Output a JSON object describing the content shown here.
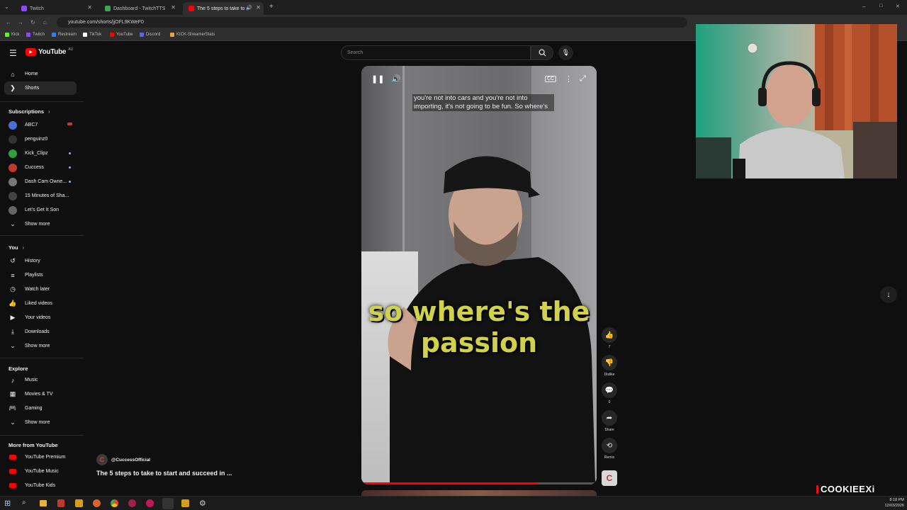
{
  "browser": {
    "tabs": [
      {
        "title": "Twitch",
        "color": "#9146ff"
      },
      {
        "title": "Dashboard - TwitchTTS",
        "color": "#3aa655"
      },
      {
        "title": "The 5 steps to take to start",
        "color": "#ff0000"
      }
    ],
    "url": "youtube.com/shorts/jjOFL9KWeF0",
    "bookmarks": [
      {
        "label": "Kick",
        "color": "#53fc18"
      },
      {
        "label": "Twitch",
        "color": "#9146ff"
      },
      {
        "label": "Restream",
        "color": "#2d7cff"
      },
      {
        "label": "TikTok",
        "color": "#ffffff"
      },
      {
        "label": "YouTube",
        "color": "#ff0000"
      },
      {
        "label": "Discord",
        "color": "#5865f2"
      },
      {
        "label": "KICK-StreamerStats",
        "color": "#e8a33b"
      }
    ]
  },
  "youtube": {
    "logo_text": "YouTube",
    "region": "AU",
    "search_placeholder": "Search"
  },
  "sidebar": {
    "main": [
      {
        "label": "Home",
        "icon": "home-icon"
      },
      {
        "label": "Shorts",
        "icon": "shorts-icon"
      }
    ],
    "subscriptions_title": "Subscriptions",
    "subscriptions": [
      {
        "label": "ABC7",
        "color": "#4a6fd4"
      },
      {
        "label": "penguinz0",
        "color": "#333333"
      },
      {
        "label": "Kick_Clipz",
        "color": "#2ea043"
      },
      {
        "label": "Cuccess",
        "color": "#c0392b"
      },
      {
        "label": "Dash Cam Owne...",
        "color": "#777777"
      },
      {
        "label": "15 Minutes of Sha...",
        "color": "#444444"
      },
      {
        "label": "Let's Get It Son",
        "color": "#666666"
      }
    ],
    "subs_show_more": "Show more",
    "you_title": "You",
    "you": [
      {
        "label": "History",
        "icon": "history-icon"
      },
      {
        "label": "Playlists",
        "icon": "playlists-icon"
      },
      {
        "label": "Watch later",
        "icon": "watch-later-icon"
      },
      {
        "label": "Liked videos",
        "icon": "thumbs-up-icon"
      },
      {
        "label": "Your videos",
        "icon": "play-icon"
      },
      {
        "label": "Downloads",
        "icon": "download-icon"
      }
    ],
    "you_show_more": "Show more",
    "explore_title": "Explore",
    "explore": [
      {
        "label": "Music",
        "icon": "music-icon"
      },
      {
        "label": "Movies & TV",
        "icon": "film-icon"
      },
      {
        "label": "Gaming",
        "icon": "gamepad-icon"
      }
    ],
    "explore_show_more": "Show more",
    "more_title": "More from YouTube",
    "more": [
      {
        "label": "YouTube Premium"
      },
      {
        "label": "YouTube Music"
      },
      {
        "label": "YouTube Kids"
      }
    ]
  },
  "short": {
    "caption_top": "you're not into cars and you're not into importing, it's not going to be fun. So where's",
    "caption_big": "so where's the passion",
    "channel": "@CuccessOfficial",
    "title": "The 5 steps to take to start and succeed in ...",
    "progress": 0.75,
    "actions": {
      "like_count": "7",
      "dislike_label": "Dislike",
      "comment_count": "0",
      "share_label": "Share",
      "remix_label": "Remix"
    }
  },
  "overlay": {
    "streamer_name": "COOKIEEXi"
  },
  "taskbar": {
    "time": "8:18 PM",
    "date": "12/03/2026"
  }
}
